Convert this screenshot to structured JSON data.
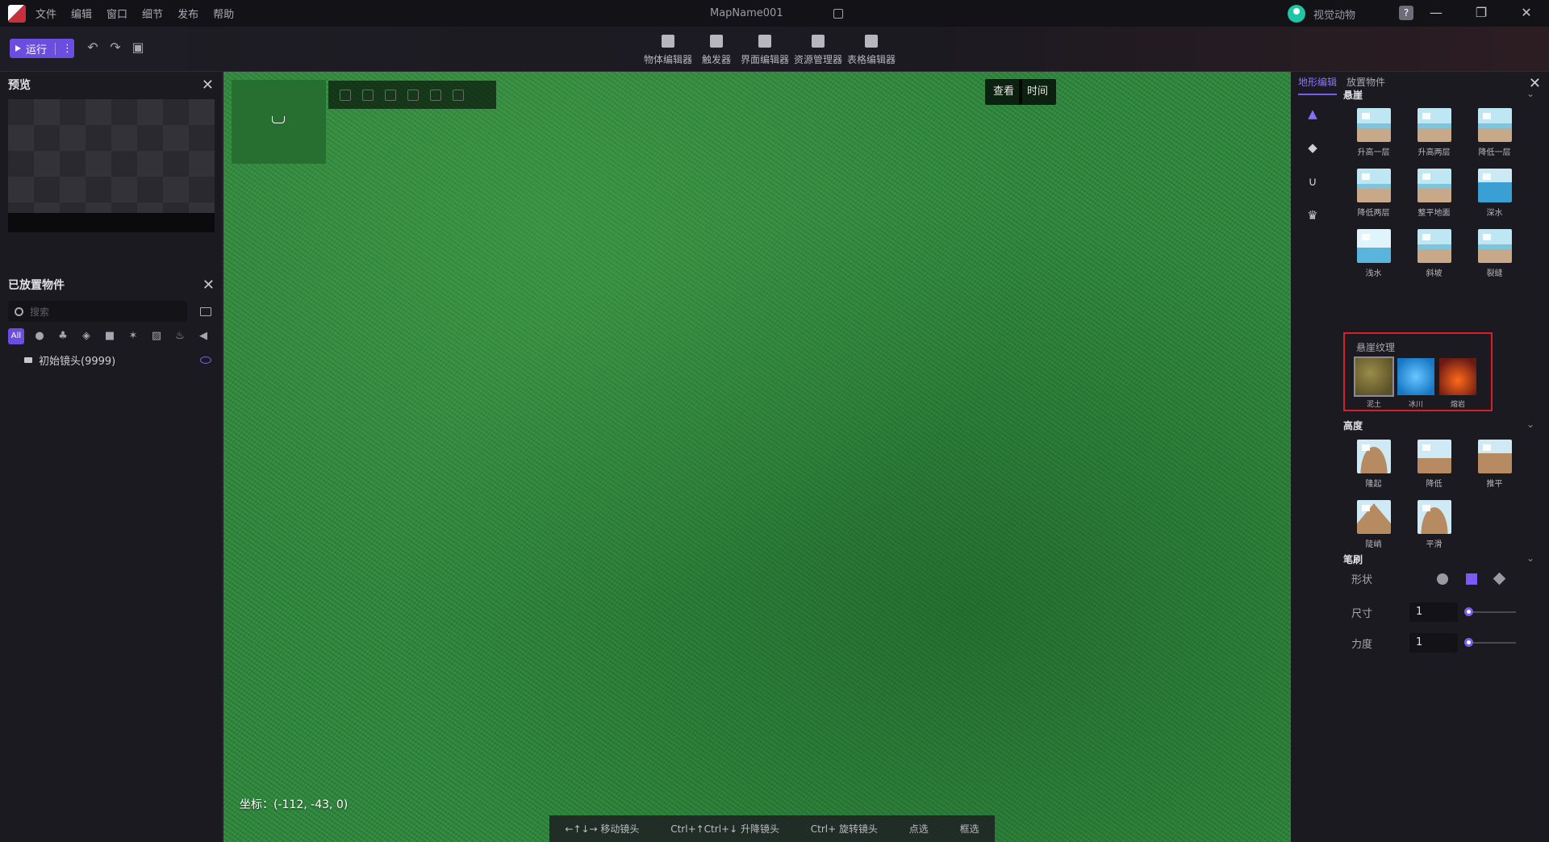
{
  "menubar": {
    "items": [
      "文件",
      "编辑",
      "窗口",
      "细节",
      "发布",
      "帮助"
    ],
    "map_name": "MapName001",
    "user_name": "视觉动物",
    "help": "?"
  },
  "toolbar": {
    "run_label": "运行",
    "more": "⋮",
    "center_tools": [
      "物体编辑器",
      "触发器",
      "界面编辑器",
      "资源管理器",
      "表格编辑器"
    ]
  },
  "left": {
    "preview_title": "预览",
    "placed_title": "已放置物件",
    "search_placeholder": "搜索",
    "filter_all": "All",
    "tree_item": "初始镜头(9999)"
  },
  "viewport": {
    "btn_view": "查看",
    "btn_time": "时间",
    "coord_label": "坐标：",
    "coord_value": "(-112, -43, 0)",
    "hints": [
      "←↑↓→ 移动镜头",
      "Ctrl+↑Ctrl+↓ 升降镜头",
      "Ctrl+ 旋转镜头",
      "点选",
      "框选"
    ]
  },
  "right": {
    "tabs": [
      "地形编辑",
      "放置物件"
    ],
    "cliff": {
      "title": "悬崖",
      "tiles": [
        "升高一层",
        "升高两层",
        "降低一层",
        "降低两层",
        "整平地面",
        "深水",
        "浅水",
        "斜坡",
        "裂缝"
      ]
    },
    "texture": {
      "title": "悬崖纹理",
      "items": [
        "泥土",
        "冰川",
        "熔岩"
      ]
    },
    "height": {
      "title": "高度",
      "tiles": [
        "隆起",
        "降低",
        "推平",
        "陡峭",
        "平滑"
      ]
    },
    "brush": {
      "title": "笔刷",
      "shape_label": "形状",
      "size_label": "尺寸",
      "size_value": "1",
      "strength_label": "力度",
      "strength_value": "1"
    }
  }
}
